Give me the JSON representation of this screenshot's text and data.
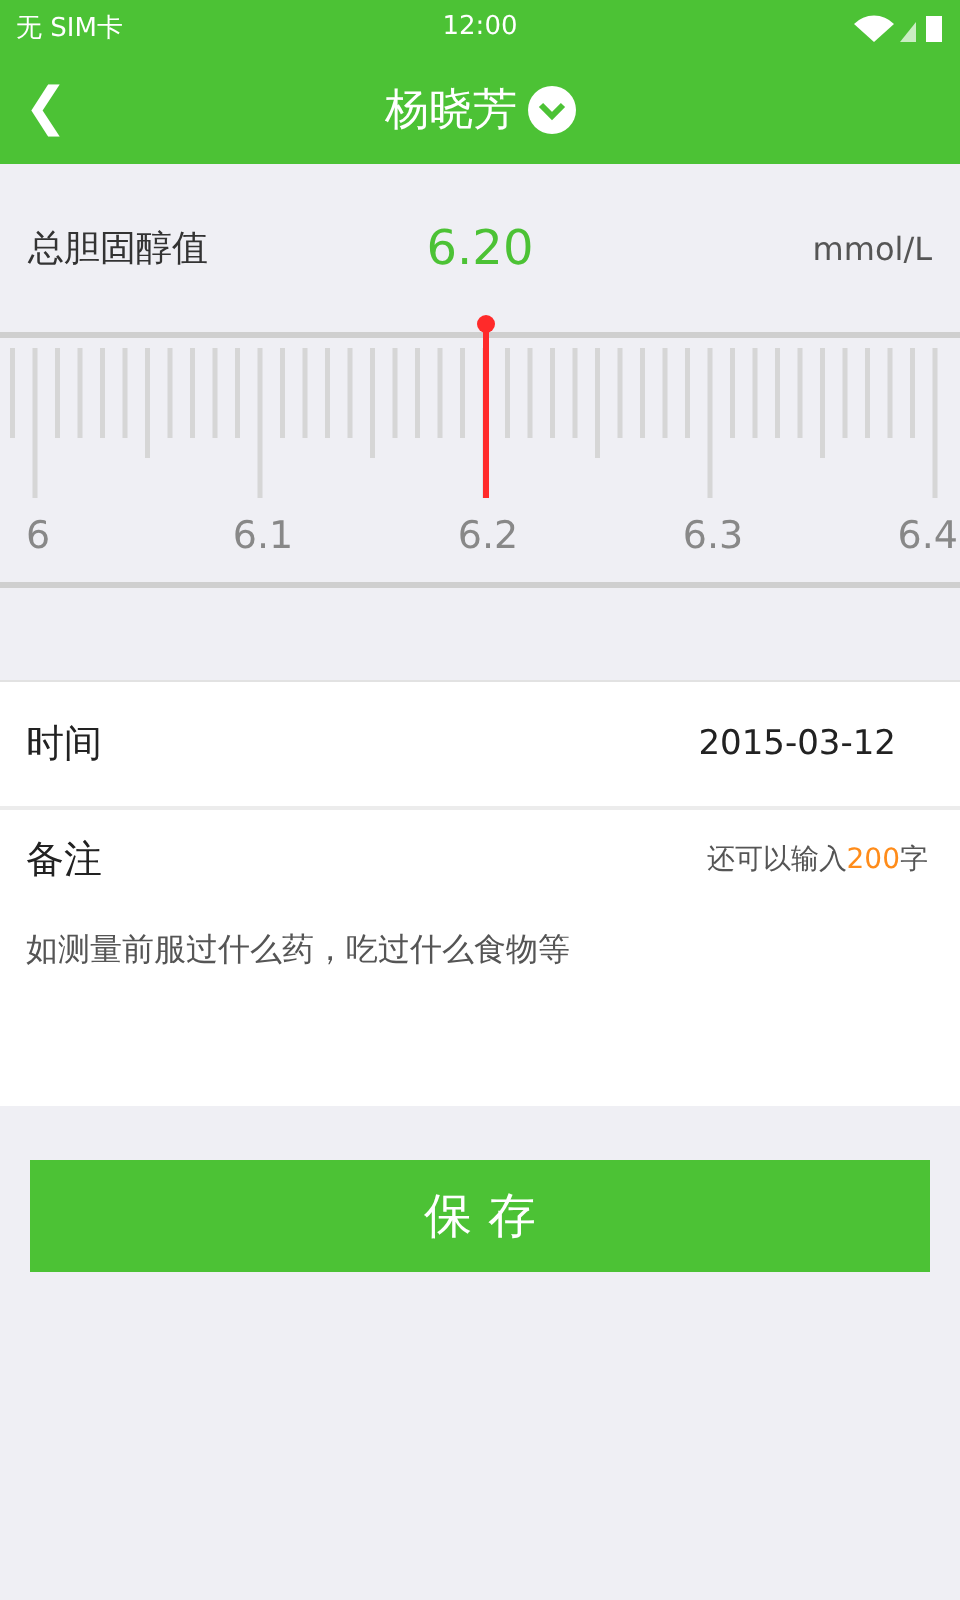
{
  "status_bar": {
    "carrier": "无  SIM卡",
    "time": "12:00"
  },
  "header": {
    "back": "❮",
    "title": "杨晓芳"
  },
  "measurement": {
    "label": "总胆固醇值",
    "value": "6.20",
    "unit": "mmol/L"
  },
  "ruler": {
    "labels": [
      "6",
      "6.1",
      "6.2",
      "6.3",
      "6.4"
    ]
  },
  "time": {
    "label": "时间",
    "value": "2015-03-12"
  },
  "note": {
    "label": "备注",
    "counter_prefix": "还可以输入",
    "counter_count": "200",
    "counter_suffix": "字",
    "placeholder": "如测量前服过什么药，吃过什么食物等"
  },
  "save_button": "保 存"
}
